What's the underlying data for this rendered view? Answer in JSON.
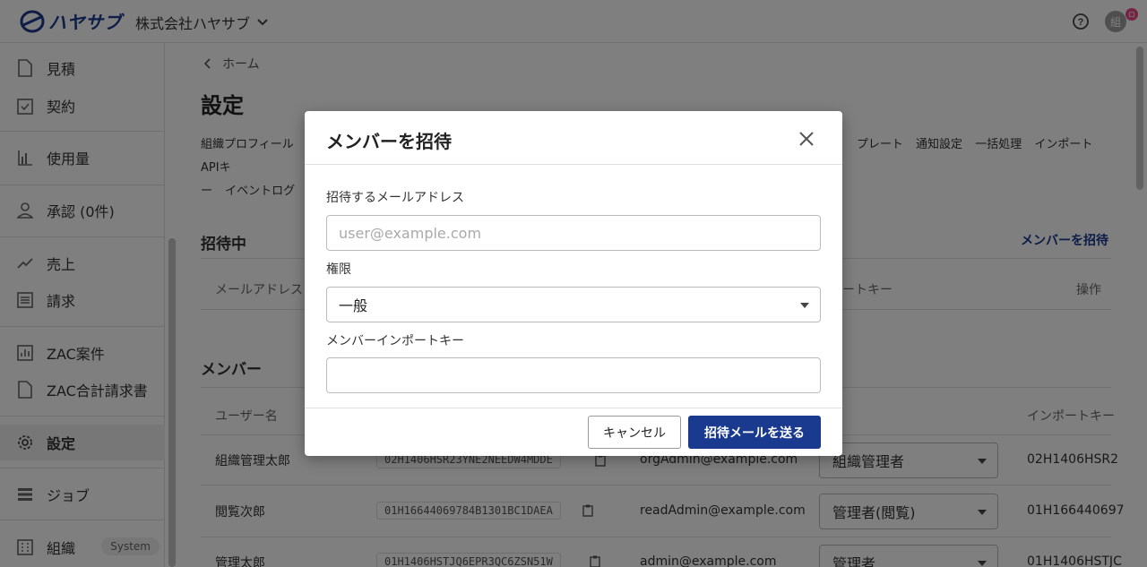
{
  "header": {
    "logo_text": "ハヤサブ",
    "org_name": "株式会社ハヤサブ",
    "avatar_initial": "組",
    "badge_text": "ロ"
  },
  "sidebar": {
    "items": [
      {
        "label": "見積",
        "icon": "document-icon"
      },
      {
        "label": "契約",
        "icon": "clipboard-check-icon"
      },
      {
        "label": "使用量",
        "icon": "bar-chart-icon"
      },
      {
        "label": "承認 (0件)",
        "icon": "person-icon"
      },
      {
        "label": "売上",
        "icon": "trending-up-icon"
      },
      {
        "label": "請求",
        "icon": "list-icon"
      },
      {
        "label": "ZAC案件",
        "icon": "bar-chart-box-icon"
      },
      {
        "label": "ZAC合計請求書",
        "icon": "document-icon"
      },
      {
        "label": "設定",
        "icon": "gear-icon"
      },
      {
        "label": "ジョブ",
        "icon": "list-rows-icon"
      },
      {
        "label": "組織",
        "icon": "building-icon",
        "chip": "System"
      }
    ]
  },
  "main": {
    "breadcrumb": "ホーム",
    "title": "設定",
    "tabs_row1": [
      "組織プロフィール",
      "プレート",
      "通知設定",
      "一括処理",
      "インポート",
      "APIキ"
    ],
    "tabs_row2": [
      "ー",
      "イベントログ"
    ],
    "invited_section": "招待中",
    "invite_link": "メンバーを招待",
    "invited_headers": {
      "email": "メールアドレス",
      "import_key": "ートキー",
      "actions": "操作"
    },
    "members_section": "メンバー",
    "members_headers": {
      "user_name": "ユーザー名",
      "import_key": "インポートキー"
    },
    "members": [
      {
        "name": "組織管理太郎",
        "id": "02H1406HSR23YNE2NEEDW4MDDE",
        "email": "orgAdmin@example.com",
        "role": "組織管理者",
        "import_key": "02H1406HSR2"
      },
      {
        "name": "閲覧次郎",
        "id": "01H16644069784B1301BC1DAEA",
        "email": "readAdmin@example.com",
        "role": "管理者(閲覧)",
        "import_key": "01H166440697"
      },
      {
        "name": "管理太郎",
        "id": "01H1406HSTJQ6EPR3QC6ZSN51W",
        "email": "admin@example.com",
        "role": "管理者",
        "import_key": "01H1406HSTJC"
      }
    ]
  },
  "modal": {
    "title": "メンバーを招待",
    "email_label": "招待するメールアドレス",
    "email_placeholder": "user@example.com",
    "email_value": "",
    "role_label": "権限",
    "role_value": "一般",
    "import_key_label": "メンバーインポートキー",
    "import_key_value": "",
    "cancel_label": "キャンセル",
    "send_label": "招待メールを送る"
  },
  "colors": {
    "brand": "#1a3a8f",
    "overlay": "rgba(0,0,0,0.5)"
  }
}
